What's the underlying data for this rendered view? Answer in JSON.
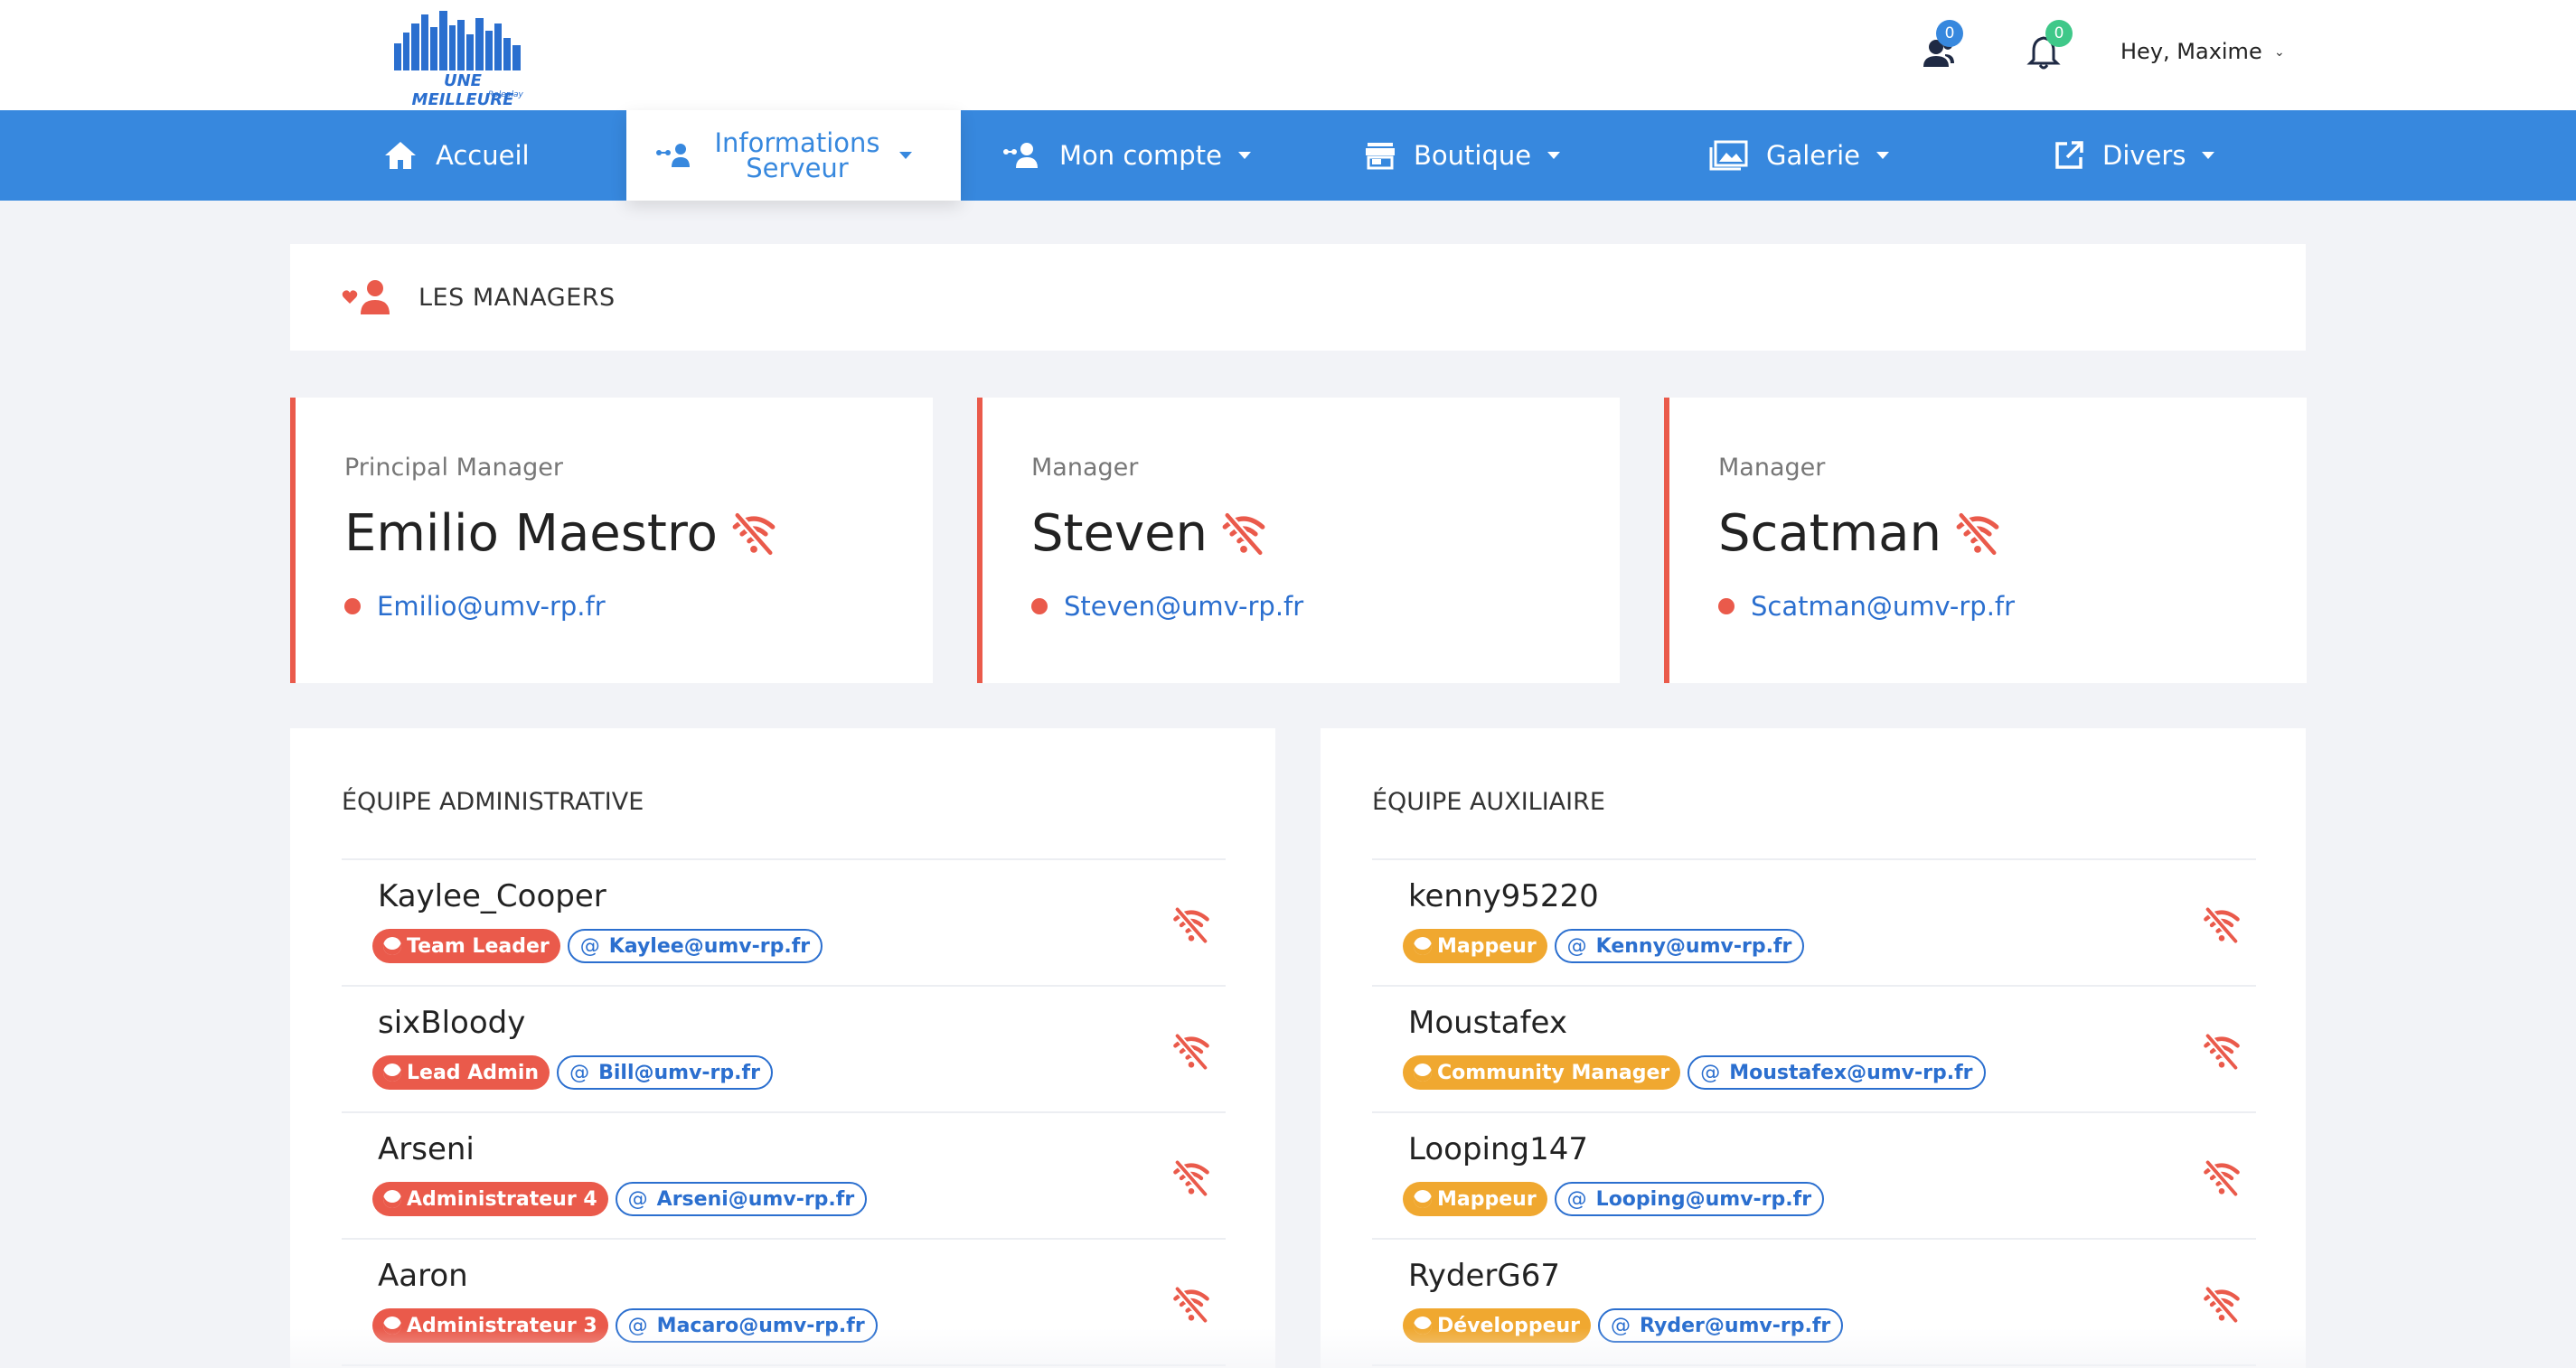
{
  "brand": {
    "logo_text": "UNE MEILLEURE VIE",
    "logo_sub": "Roleplay"
  },
  "topbar": {
    "friends_badge": "0",
    "notif_badge": "0",
    "greeting": "Hey, Maxime",
    "friends_icon": "users-icon",
    "notif_icon": "bell-icon"
  },
  "nav": {
    "items": [
      {
        "label": "Accueil",
        "icon": "home-icon"
      },
      {
        "label": "Informations Serveur",
        "icon": "network-icon",
        "active": true
      },
      {
        "label": "Mon compte",
        "icon": "user-network-icon"
      },
      {
        "label": "Boutique",
        "icon": "store-icon"
      },
      {
        "label": "Galerie",
        "icon": "gallery-icon"
      },
      {
        "label": "Divers",
        "icon": "external-link-icon"
      }
    ]
  },
  "header": {
    "title": "LES MANAGERS",
    "icon": "user-heart-icon"
  },
  "managers": [
    {
      "role": "Principal Manager",
      "name": "Emilio Maestro",
      "email": "Emilio@umv-rp.fr"
    },
    {
      "role": "Manager",
      "name": "Steven",
      "email": "Steven@umv-rp.fr"
    },
    {
      "role": "Manager",
      "name": "Scatman",
      "email": "Scatman@umv-rp.fr"
    }
  ],
  "teams": {
    "admin": {
      "title": "ÉQUIPE ADMINISTRATIVE",
      "members": [
        {
          "name": "Kaylee_Cooper",
          "role": "Team Leader",
          "email": "Kaylee@umv-rp.fr"
        },
        {
          "name": "sixBloody",
          "role": "Lead Admin",
          "email": "Bill@umv-rp.fr"
        },
        {
          "name": "Arseni",
          "role": "Administrateur 4",
          "email": "Arseni@umv-rp.fr"
        },
        {
          "name": "Aaron",
          "role": "Administrateur 3",
          "email": "Macaro@umv-rp.fr"
        }
      ]
    },
    "aux": {
      "title": "ÉQUIPE AUXILIAIRE",
      "members": [
        {
          "name": "kenny95220",
          "role": "Mappeur",
          "email": "Kenny@umv-rp.fr"
        },
        {
          "name": "Moustafex",
          "role": "Community Manager",
          "email": "Moustafex@umv-rp.fr"
        },
        {
          "name": "Looping147",
          "role": "Mappeur",
          "email": "Looping@umv-rp.fr"
        },
        {
          "name": "RyderG67",
          "role": "Développeur",
          "email": "Ryder@umv-rp.fr"
        }
      ]
    }
  },
  "colors": {
    "nav_blue": "#3788de",
    "admin_red": "#ea5a4b",
    "aux_orange": "#f0a830",
    "link_blue": "#2b6fcf"
  },
  "status_icon": "wifi-off-icon"
}
